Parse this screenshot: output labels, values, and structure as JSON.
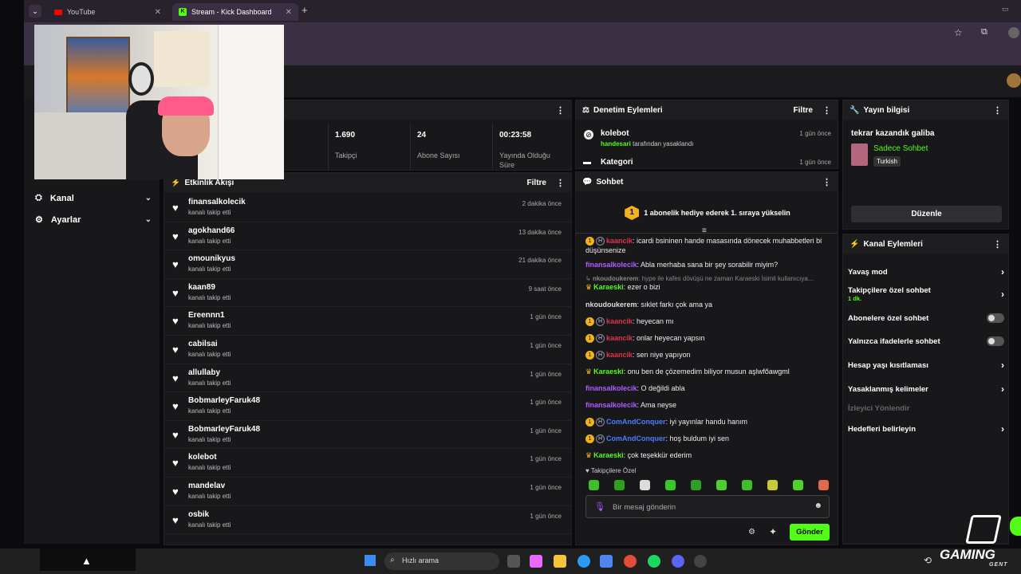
{
  "browser": {
    "tabs": [
      {
        "label": "YouTube"
      },
      {
        "label": "Stream - Kick Dashboard"
      }
    ]
  },
  "sidebar": {
    "items": [
      {
        "label": "Kanal"
      },
      {
        "label": "Ayarlar"
      }
    ]
  },
  "stats": [
    {
      "value": "1.690",
      "label": "Takipçi"
    },
    {
      "value": "24",
      "label": "Abone Sayısı"
    },
    {
      "value": "00:23:58",
      "label": "Yayında Olduğu Süre"
    }
  ],
  "activity": {
    "title": "Etkinlik Akışı",
    "filter": "Filtre",
    "rows": [
      {
        "name": "finansalkolecik",
        "action": "kanalı takip etti",
        "time": "2 dakika önce"
      },
      {
        "name": "agokhand66",
        "action": "kanalı takip etti",
        "time": "13 dakika önce"
      },
      {
        "name": "omounikyus",
        "action": "kanalı takip etti",
        "time": "21 dakika önce"
      },
      {
        "name": "kaan89",
        "action": "kanalı takip etti",
        "time": "9 saat önce"
      },
      {
        "name": "Ereennn1",
        "action": "kanalı takip etti",
        "time": "1 gün önce"
      },
      {
        "name": "cabilsai",
        "action": "kanalı takip etti",
        "time": "1 gün önce"
      },
      {
        "name": "allullaby",
        "action": "kanalı takip etti",
        "time": "1 gün önce"
      },
      {
        "name": "BobmarleyFaruk48",
        "action": "kanalı takip etti",
        "time": "1 gün önce"
      },
      {
        "name": "BobmarleyFaruk48",
        "action": "kanalı takip etti",
        "time": "1 gün önce"
      },
      {
        "name": "kolebot",
        "action": "kanalı takip etti",
        "time": "1 gün önce"
      },
      {
        "name": "mandelav",
        "action": "kanalı takip etti",
        "time": "1 gün önce"
      },
      {
        "name": "osbik",
        "action": "kanalı takip etti",
        "time": "1 gün önce"
      }
    ]
  },
  "moderation": {
    "title": "Denetim Eylemleri",
    "filter": "Filtre",
    "items": [
      {
        "name": "kolebot",
        "by": "handesari",
        "text": "tarafından yasaklandı",
        "time": "1 gün önce"
      },
      {
        "name": "Kategori",
        "time": "1 gün önce"
      }
    ]
  },
  "chat": {
    "title": "Sohbet",
    "banner_num": "1",
    "banner": "1 abonelik hediye ederek 1. sıraya yükselin",
    "lines": [
      {
        "user": "kaancik",
        "text": ": icardi bsininen hande masasında dönecek muhabbetleri bi düşünsenize",
        "cls": "u-red",
        "badges": "1H"
      },
      {
        "user": "finansalkolecik",
        "text": ": Abla merhaba sana bir şey sorabilir miyim?",
        "cls": "u-purple",
        "badges": ""
      },
      {
        "user": "nkoudoukerem",
        "text": ": hype ile kafes dövüşü ne zaman Karaeski İsimli kullanıcıya...",
        "cls": "u-white",
        "badges": "reply"
      },
      {
        "user": "Karaeski",
        "text": ": ezer o bizi",
        "cls": "u-green",
        "badges": "crown"
      },
      {
        "user": "nkoudoukerem",
        "text": ": sıklet farkı çok ama ya",
        "cls": "u-white",
        "badges": ""
      },
      {
        "user": "kaancik",
        "text": ": heyecan mı",
        "cls": "u-red",
        "badges": "1H"
      },
      {
        "user": "kaancik",
        "text": ": onlar heyecan yapsın",
        "cls": "u-red",
        "badges": "1H"
      },
      {
        "user": "kaancik",
        "text": ": sen niye yapıyon",
        "cls": "u-red",
        "badges": "1H"
      },
      {
        "user": "Karaeski",
        "text": ": onu ben de çözemedim biliyor musun aşlwfőawgml",
        "cls": "u-green",
        "badges": "crown"
      },
      {
        "user": "finansalkolecik",
        "text": ": O değildi abla",
        "cls": "u-purple",
        "badges": ""
      },
      {
        "user": "finansalkolecik",
        "text": ": Ama neyse",
        "cls": "u-purple",
        "badges": ""
      },
      {
        "user": "ComAndConquer",
        "text": ": iyi yayınlar handu hanım",
        "cls": "u-blue",
        "badges": "1H"
      },
      {
        "user": "ComAndConquer",
        "text": ": hoş buldum iyi sen",
        "cls": "u-blue",
        "badges": "1H"
      },
      {
        "user": "Karaeski",
        "text": ": çok teşekkür ederim",
        "cls": "u-green",
        "badges": "crown"
      }
    ],
    "followers_only": "Takipçilere Özel",
    "placeholder": "Bir mesaj gönderin",
    "send": "Gönder"
  },
  "stream_info": {
    "title": "Yayın bilgisi",
    "stream_title": "tekrar kazandık galiba",
    "category": "Sadece Sohbet",
    "language": "Turkish",
    "edit": "Düzenle"
  },
  "channel_actions": {
    "title": "Kanal Eylemleri",
    "rows": [
      {
        "label": "Yavaş mod",
        "sub": "",
        "ctrl": "chev"
      },
      {
        "label": "Takipçilere özel sohbet",
        "sub": "1 dk.",
        "ctrl": "chev"
      },
      {
        "label": "Abonelere özel sohbet",
        "sub": "",
        "ctrl": "toggle"
      },
      {
        "label": "Yalnızca ifadelerle sohbet",
        "sub": "",
        "ctrl": "toggle"
      },
      {
        "label": "Hesap yaşı kısıtlaması",
        "sub": "",
        "ctrl": "chev"
      },
      {
        "label": "Yasaklanmış kelimeler",
        "sub": "",
        "ctrl": "chev"
      },
      {
        "label": "İzleyici Yönlendir",
        "sub": "",
        "ctrl": "none"
      },
      {
        "label": "Hedefleri belirleyin",
        "sub": "",
        "ctrl": "chev"
      }
    ]
  },
  "taskbar": {
    "search": "Hızlı arama"
  },
  "overlay": {
    "brand_top": "GAMING",
    "brand_bottom": "GENT"
  },
  "colors": {
    "accent": "#53fc18",
    "bg": "#18181b",
    "browser": "#3a2f43"
  }
}
